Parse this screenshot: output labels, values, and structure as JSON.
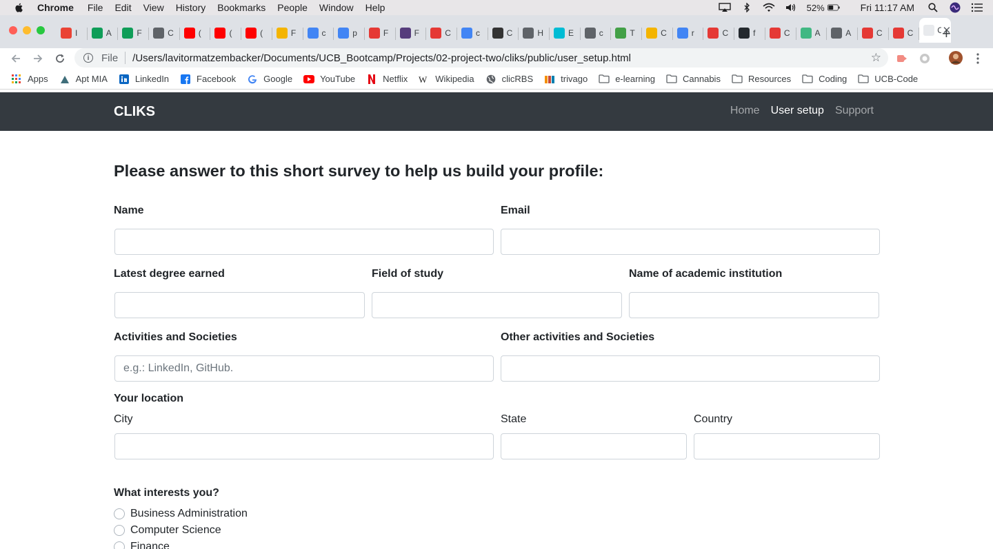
{
  "menubar": {
    "app": "Chrome",
    "items": [
      "File",
      "Edit",
      "View",
      "History",
      "Bookmarks",
      "People",
      "Window",
      "Help"
    ],
    "battery": "52%",
    "clock": "Fri 11:17 AM"
  },
  "tabs": {
    "items": [
      {
        "fav_color": "#ea4335",
        "text": "I"
      },
      {
        "fav_color": "#0f9d58",
        "text": "A"
      },
      {
        "fav_color": "#0f9d58",
        "text": "F"
      },
      {
        "fav_color": "#5f6368",
        "text": "C"
      },
      {
        "fav_color": "#ff0000",
        "text": "("
      },
      {
        "fav_color": "#ff0000",
        "text": "("
      },
      {
        "fav_color": "#ff0000",
        "text": "("
      },
      {
        "fav_color": "#f4b400",
        "text": "F"
      },
      {
        "fav_color": "#4285f4",
        "text": "c"
      },
      {
        "fav_color": "#4285f4",
        "text": "p"
      },
      {
        "fav_color": "#e53935",
        "text": "F"
      },
      {
        "fav_color": "#563d7c",
        "text": "F"
      },
      {
        "fav_color": "#e53935",
        "text": "C"
      },
      {
        "fav_color": "#4285f4",
        "text": "c"
      },
      {
        "fav_color": "#333333",
        "text": "C"
      },
      {
        "fav_color": "#5f6368",
        "text": "H"
      },
      {
        "fav_color": "#00bcd4",
        "text": "E"
      },
      {
        "fav_color": "#5f6368",
        "text": "c"
      },
      {
        "fav_color": "#43a047",
        "text": "T"
      },
      {
        "fav_color": "#f4b400",
        "text": "C"
      },
      {
        "fav_color": "#4285f4",
        "text": "r"
      },
      {
        "fav_color": "#e53935",
        "text": "C"
      },
      {
        "fav_color": "#24292e",
        "text": "f"
      },
      {
        "fav_color": "#e53935",
        "text": "C"
      },
      {
        "fav_color": "#41b883",
        "text": "A"
      },
      {
        "fav_color": "#5f6368",
        "text": "A"
      },
      {
        "fav_color": "#e53935",
        "text": "C"
      },
      {
        "fav_color": "#e53935",
        "text": "C"
      }
    ],
    "active_title": "C",
    "new_tab": "+"
  },
  "toolbar": {
    "scheme": "File",
    "url": "/Users/lavitormatzembacker/Documents/UCB_Bootcamp/Projects/02-project-two/cliks/public/user_setup.html"
  },
  "bookmarks": [
    {
      "label": "Apps",
      "icon": "apps-grid-icon"
    },
    {
      "label": "Apt MIA",
      "icon": "apt-mia-icon"
    },
    {
      "label": "LinkedIn",
      "icon": "linkedin-icon"
    },
    {
      "label": "Facebook",
      "icon": "facebook-icon"
    },
    {
      "label": "Google",
      "icon": "google-icon"
    },
    {
      "label": "YouTube",
      "icon": "youtube-icon"
    },
    {
      "label": "Netflix",
      "icon": "netflix-icon"
    },
    {
      "label": "Wikipedia",
      "icon": "wikipedia-icon"
    },
    {
      "label": "clicRBS",
      "icon": "globe-icon"
    },
    {
      "label": "trivago",
      "icon": "trivago-icon"
    },
    {
      "label": "e-learning",
      "icon": "folder-icon"
    },
    {
      "label": "Cannabis",
      "icon": "folder-icon"
    },
    {
      "label": "Resources",
      "icon": "folder-icon"
    },
    {
      "label": "Coding",
      "icon": "folder-icon"
    },
    {
      "label": "UCB-Code",
      "icon": "folder-icon"
    }
  ],
  "site": {
    "brand": "CLIKS",
    "nav": [
      {
        "label": "Home",
        "active": false
      },
      {
        "label": "User setup",
        "active": true
      },
      {
        "label": "Support",
        "active": false
      }
    ]
  },
  "form": {
    "heading": "Please answer to this short survey to help us build your profile:",
    "name_label": "Name",
    "email_label": "Email",
    "degree_label": "Latest degree earned",
    "field_label": "Field of study",
    "institution_label": "Name of academic institution",
    "activities_label": "Activities and Societies",
    "activities_placeholder": "e.g.: LinkedIn, GitHub.",
    "other_activities_label": "Other activities and Societies",
    "location_label": "Your location",
    "city_label": "City",
    "state_label": "State",
    "country_label": "Country",
    "interests_label": "What interests you?",
    "interests": [
      "Business Administration",
      "Computer Science",
      "Finance"
    ]
  }
}
